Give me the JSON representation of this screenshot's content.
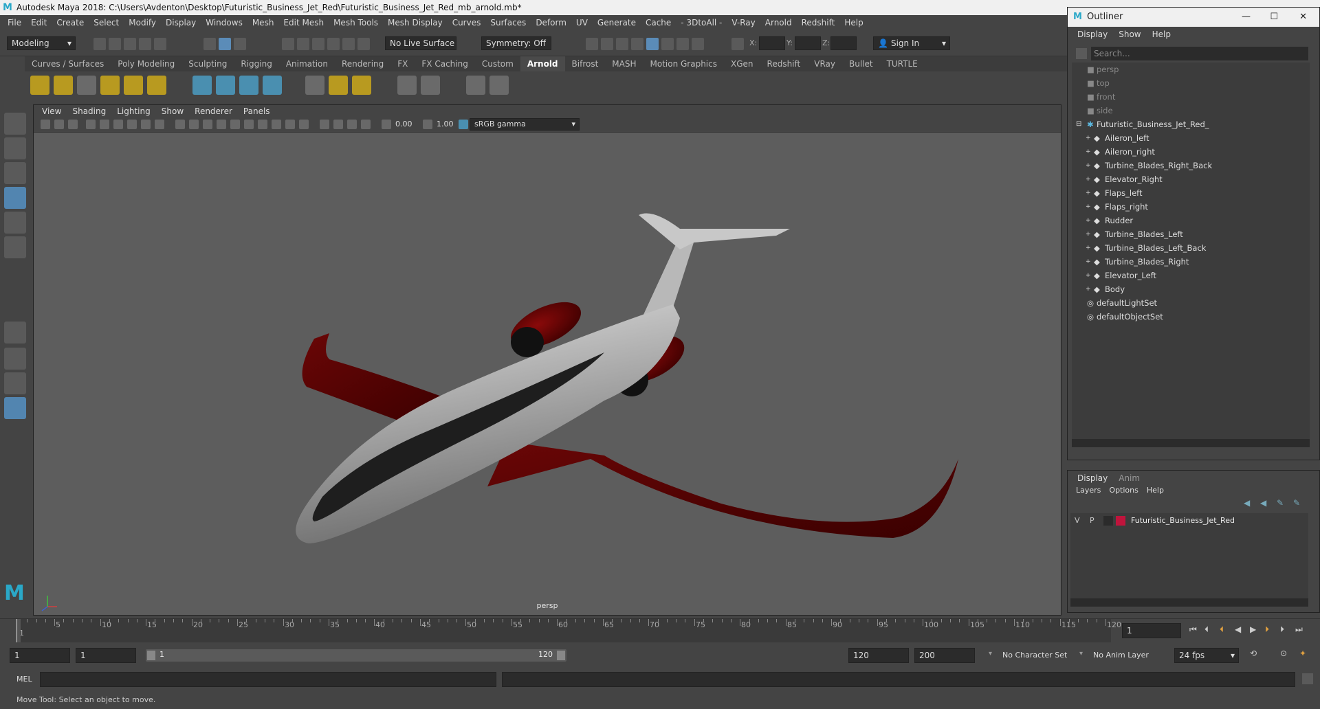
{
  "window": {
    "title": "Autodesk Maya 2018: C:\\Users\\Avdenton\\Desktop\\Futuristic_Business_Jet_Red\\Futuristic_Business_Jet_Red_mb_arnold.mb*"
  },
  "menubar": [
    "File",
    "Edit",
    "Create",
    "Select",
    "Modify",
    "Display",
    "Windows",
    "Mesh",
    "Edit Mesh",
    "Mesh Tools",
    "Mesh Display",
    "Curves",
    "Surfaces",
    "Deform",
    "UV",
    "Generate",
    "Cache",
    "- 3DtoAll -",
    "V-Ray",
    "Arnold",
    "Redshift",
    "Help"
  ],
  "status": {
    "mode": "Modeling",
    "live_surface": "No Live Surface",
    "symmetry": "Symmetry: Off",
    "x_label": "X:",
    "y_label": "Y:",
    "z_label": "Z:",
    "sign_in": "Sign In"
  },
  "shelf_tabs": [
    "Curves / Surfaces",
    "Poly Modeling",
    "Sculpting",
    "Rigging",
    "Animation",
    "Rendering",
    "FX",
    "FX Caching",
    "Custom",
    "Arnold",
    "Bifrost",
    "MASH",
    "Motion Graphics",
    "XGen",
    "Redshift",
    "VRay",
    "Bullet",
    "TURTLE"
  ],
  "shelf_active": "Arnold",
  "panel": {
    "menu": [
      "View",
      "Shading",
      "Lighting",
      "Show",
      "Renderer",
      "Panels"
    ],
    "exposure": "0.00",
    "gamma": "1.00",
    "colorspace": "sRGB gamma",
    "camera_label": "persp"
  },
  "outliner": {
    "title": "Outliner",
    "menu": [
      "Display",
      "Show",
      "Help"
    ],
    "search_placeholder": "Search...",
    "cameras": [
      "persp",
      "top",
      "front",
      "side"
    ],
    "root": "Futuristic_Business_Jet_Red_",
    "children": [
      "Aileron_left",
      "Aileron_right",
      "Turbine_Blades_Right_Back",
      "Elevator_Right",
      "Flaps_left",
      "Flaps_right",
      "Rudder",
      "Turbine_Blades_Left",
      "Turbine_Blades_Left_Back",
      "Turbine_Blades_Right",
      "Elevator_Left",
      "Body"
    ],
    "sets": [
      "defaultLightSet",
      "defaultObjectSet"
    ]
  },
  "layers": {
    "tabs": [
      "Display",
      "Anim"
    ],
    "menu": [
      "Layers",
      "Options",
      "Help"
    ],
    "v": "V",
    "p": "P",
    "layer_name": "Futuristic_Business_Jet_Red",
    "layer_color": "#c0143c"
  },
  "timeline": {
    "tick_labels": [
      "1",
      "5",
      "10",
      "15",
      "20",
      "25",
      "30",
      "35",
      "40",
      "45",
      "50",
      "55",
      "60",
      "65",
      "70",
      "75",
      "80",
      "85",
      "90",
      "95",
      "100",
      "105",
      "110",
      "115",
      "120"
    ],
    "current_frame": "1"
  },
  "range": {
    "start": "1",
    "start2": "1",
    "slider_start": "1",
    "slider_end": "120",
    "end": "120",
    "max": "200",
    "char_set": "No Character Set",
    "anim_layer": "No Anim Layer",
    "fps": "24 fps"
  },
  "cmd": {
    "label": "MEL"
  },
  "help": {
    "text": "Move Tool: Select an object to move."
  }
}
